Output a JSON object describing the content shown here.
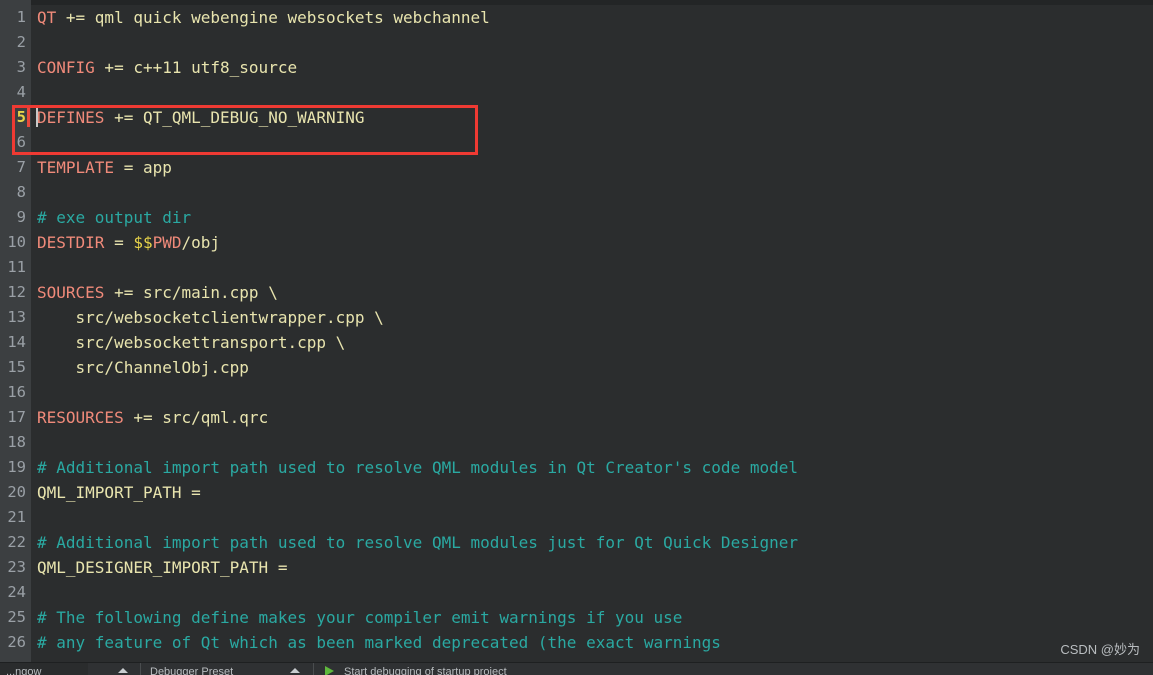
{
  "app": {
    "name": "qt-creator-editor",
    "theme": "dark"
  },
  "colors": {
    "editor_background": "#2b2d2e",
    "gutter_background": "#3c3f41",
    "line_number": "#9aa0a6",
    "current_line_number": "#e8d44a",
    "keyword": "#f08a7a",
    "value": "#e8e4ae",
    "comment": "#2aa9a2",
    "variable": "#e8d44a",
    "annotation_rect": "#ef3a33",
    "bookmark_marker": "#e8483c",
    "caret": "#c8c8c8",
    "statusbar_background": "#2f3133",
    "run_icon": "#5fb83d"
  },
  "editor": {
    "current_line": 5,
    "lines": [
      {
        "n": "1",
        "tokens": [
          {
            "c": "t-key",
            "t": "QT"
          },
          {
            "c": "t-op",
            "t": " += "
          },
          {
            "c": "t-val",
            "t": "qml quick webengine websockets webchannel"
          }
        ]
      },
      {
        "n": "2",
        "tokens": []
      },
      {
        "n": "3",
        "tokens": [
          {
            "c": "t-key",
            "t": "CONFIG"
          },
          {
            "c": "t-op",
            "t": " += "
          },
          {
            "c": "t-val",
            "t": "c++11 utf8_source"
          }
        ]
      },
      {
        "n": "4",
        "tokens": []
      },
      {
        "n": "5",
        "tokens": [
          {
            "c": "t-key",
            "t": "DEFINES"
          },
          {
            "c": "t-op",
            "t": " += "
          },
          {
            "c": "t-val",
            "t": "QT_QML_DEBUG_NO_WARNING"
          }
        ]
      },
      {
        "n": "6",
        "tokens": []
      },
      {
        "n": "7",
        "tokens": [
          {
            "c": "t-key",
            "t": "TEMPLATE"
          },
          {
            "c": "t-op",
            "t": " = "
          },
          {
            "c": "t-val",
            "t": "app"
          }
        ]
      },
      {
        "n": "8",
        "tokens": []
      },
      {
        "n": "9",
        "tokens": [
          {
            "c": "t-cmt",
            "t": "# exe output dir"
          }
        ]
      },
      {
        "n": "10",
        "tokens": [
          {
            "c": "t-key",
            "t": "DESTDIR"
          },
          {
            "c": "t-op",
            "t": " = "
          },
          {
            "c": "t-var",
            "t": "$$"
          },
          {
            "c": "t-key",
            "t": "PWD"
          },
          {
            "c": "t-val",
            "t": "/obj"
          }
        ]
      },
      {
        "n": "11",
        "tokens": []
      },
      {
        "n": "12",
        "tokens": [
          {
            "c": "t-key",
            "t": "SOURCES"
          },
          {
            "c": "t-op",
            "t": " += "
          },
          {
            "c": "t-val",
            "t": "src/main.cpp \\"
          }
        ]
      },
      {
        "n": "13",
        "tokens": [
          {
            "c": "t-val",
            "t": "    src/websocketclientwrapper.cpp \\"
          }
        ]
      },
      {
        "n": "14",
        "tokens": [
          {
            "c": "t-val",
            "t": "    src/websockettransport.cpp \\"
          }
        ]
      },
      {
        "n": "15",
        "tokens": [
          {
            "c": "t-val",
            "t": "    src/ChannelObj.cpp"
          }
        ]
      },
      {
        "n": "16",
        "tokens": []
      },
      {
        "n": "17",
        "tokens": [
          {
            "c": "t-key",
            "t": "RESOURCES"
          },
          {
            "c": "t-op",
            "t": " += "
          },
          {
            "c": "t-val",
            "t": "src/qml.qrc"
          }
        ]
      },
      {
        "n": "18",
        "tokens": []
      },
      {
        "n": "19",
        "tokens": [
          {
            "c": "t-cmt",
            "t": "# Additional import path used to resolve QML modules in Qt Creator's code model"
          }
        ]
      },
      {
        "n": "20",
        "tokens": [
          {
            "c": "t-val",
            "t": "QML_IMPORT_PATH ="
          }
        ]
      },
      {
        "n": "21",
        "tokens": []
      },
      {
        "n": "22",
        "tokens": [
          {
            "c": "t-cmt",
            "t": "# Additional import path used to resolve QML modules just for Qt Quick Designer"
          }
        ]
      },
      {
        "n": "23",
        "tokens": [
          {
            "c": "t-val",
            "t": "QML_DESIGNER_IMPORT_PATH ="
          }
        ]
      },
      {
        "n": "24",
        "tokens": []
      },
      {
        "n": "25",
        "tokens": [
          {
            "c": "t-cmt",
            "t": "# The following define makes your compiler emit warnings if you use"
          }
        ]
      },
      {
        "n": "26",
        "tokens": [
          {
            "c": "t-cmt",
            "t": "# any feature of Qt which as been marked deprecated (the exact warnings"
          }
        ]
      }
    ]
  },
  "annotation": {
    "label": "highlight-rectangle-line-5"
  },
  "statusbar": {
    "kit_label": "...ngow",
    "debugger_preset_label": "Debugger Preset",
    "run_label": "Start debugging of startup project"
  },
  "watermark": {
    "text": "CSDN @妙为"
  }
}
